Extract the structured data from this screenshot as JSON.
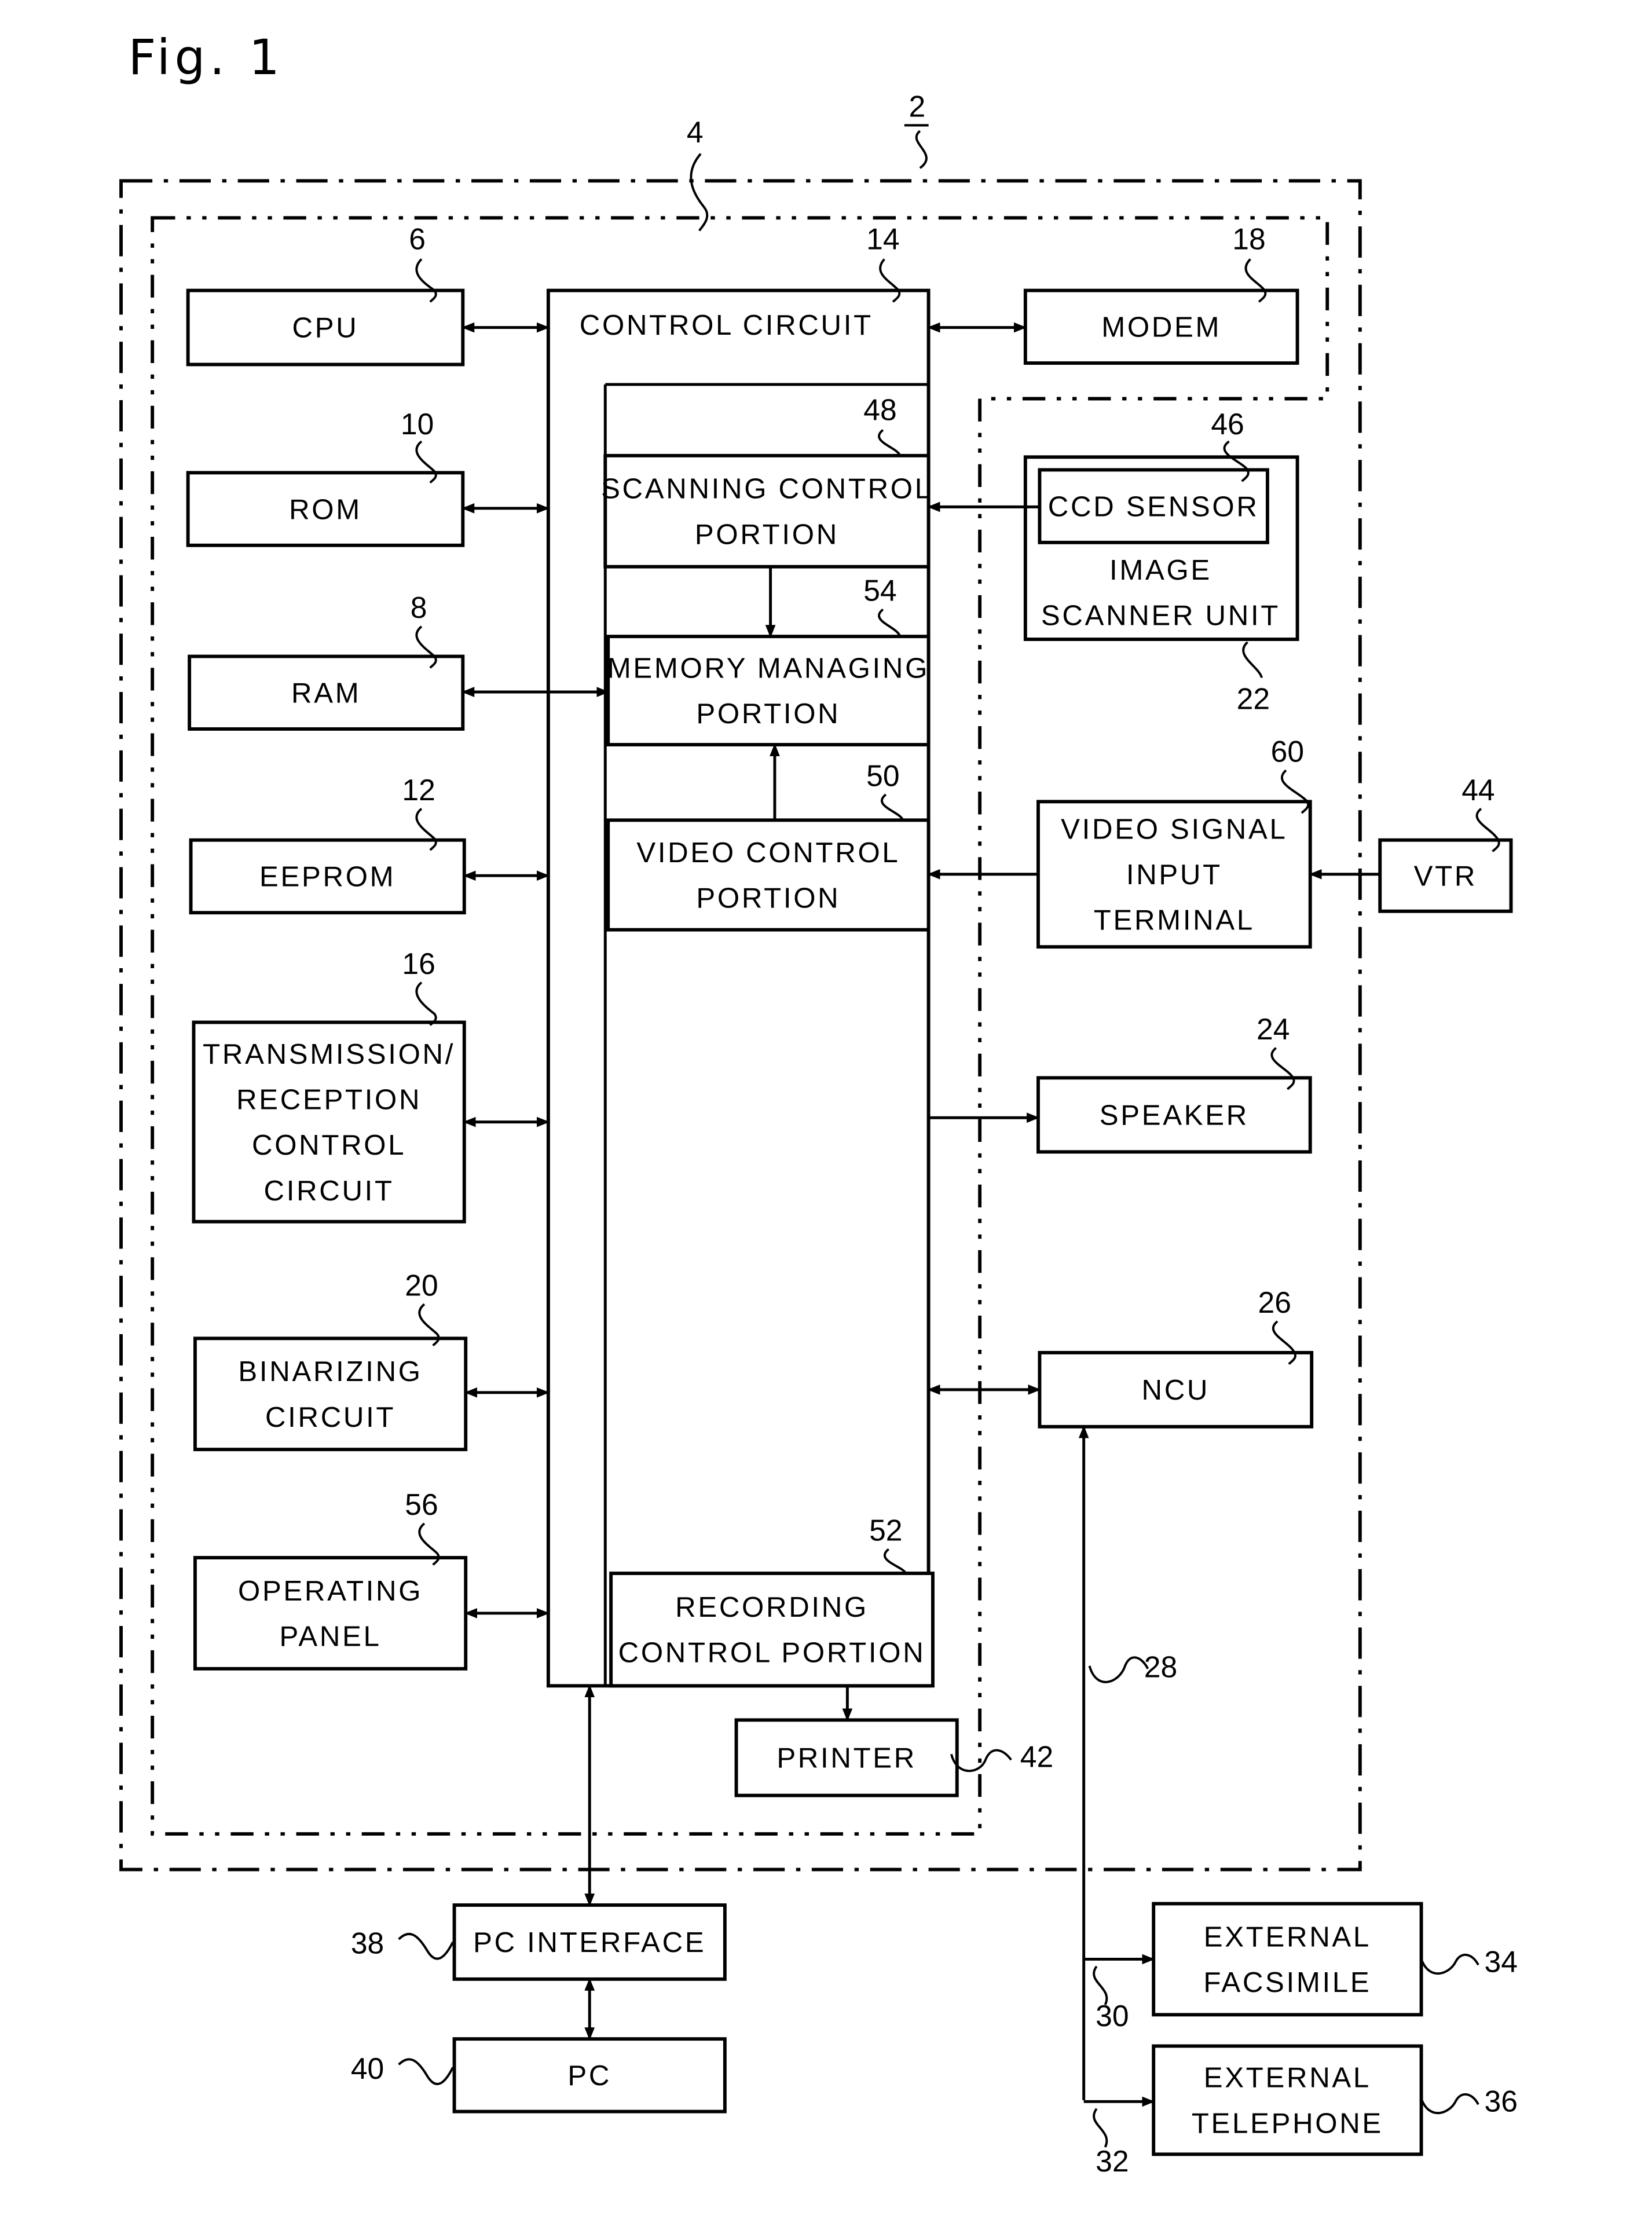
{
  "figure": {
    "title": "Fig. 1"
  },
  "colors": {
    "ink": "#000000",
    "paper": "#ffffff"
  },
  "refs": {
    "device": "2",
    "control_unit": "4",
    "cpu": "6",
    "ram": "8",
    "rom": "10",
    "eeprom": "12",
    "control_circuit": "14",
    "txrx": "16",
    "modem": "18",
    "binarizing": "20",
    "image_scanner": "22",
    "speaker": "24",
    "ncu": "26",
    "line": "28",
    "branch_fax": "30",
    "branch_tel": "32",
    "ext_fax": "34",
    "ext_tel": "36",
    "pc_interface": "38",
    "pc": "40",
    "printer": "42",
    "vtr": "44",
    "ccd": "46",
    "scanning": "48",
    "video_control": "50",
    "recording": "52",
    "memory": "54",
    "operating_panel": "56",
    "video_input": "60"
  },
  "blocks": {
    "cpu": [
      "CPU"
    ],
    "rom": [
      "ROM"
    ],
    "ram": [
      "RAM"
    ],
    "eeprom": [
      "EEPROM"
    ],
    "txrx": [
      "TRANSMISSION/",
      "RECEPTION",
      "CONTROL",
      "CIRCUIT"
    ],
    "binarizing": [
      "BINARIZING",
      "CIRCUIT"
    ],
    "operating_panel": [
      "OPERATING",
      "PANEL"
    ],
    "control_circuit": [
      "CONTROL CIRCUIT"
    ],
    "scanning": [
      "SCANNING CONTROL",
      "PORTION"
    ],
    "memory": [
      "MEMORY MANAGING",
      "PORTION"
    ],
    "video_control": [
      "VIDEO CONTROL",
      "PORTION"
    ],
    "recording": [
      "RECORDING",
      "CONTROL PORTION"
    ],
    "modem": [
      "MODEM"
    ],
    "ccd": [
      "CCD SENSOR"
    ],
    "image_scanner": [
      "IMAGE",
      "SCANNER UNIT"
    ],
    "video_input": [
      "VIDEO SIGNAL",
      "INPUT",
      "TERMINAL"
    ],
    "vtr": [
      "VTR"
    ],
    "speaker": [
      "SPEAKER"
    ],
    "ncu": [
      "NCU"
    ],
    "printer": [
      "PRINTER"
    ],
    "pc_interface": [
      "PC INTERFACE"
    ],
    "pc": [
      "PC"
    ],
    "ext_fax": [
      "EXTERNAL",
      "FACSIMILE"
    ],
    "ext_tel": [
      "EXTERNAL",
      "TELEPHONE"
    ]
  }
}
